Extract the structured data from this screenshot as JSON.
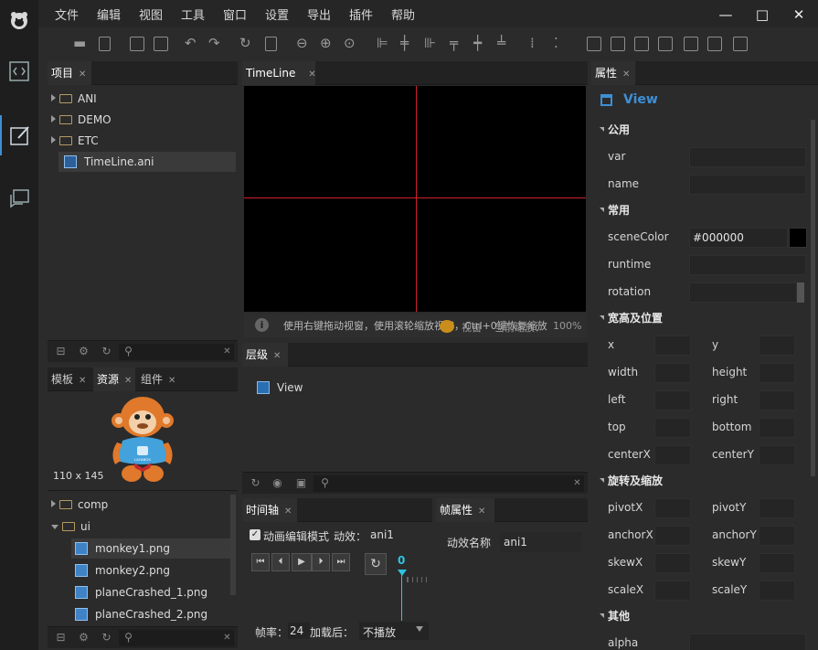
{
  "menu": [
    "文件",
    "编辑",
    "视图",
    "工具",
    "窗口",
    "设置",
    "导出",
    "插件",
    "帮助"
  ],
  "window_controls": {
    "minimize": "—",
    "maximize": "□",
    "close": "✕"
  },
  "project_panel": {
    "tab": "项目",
    "tree": [
      {
        "label": "ANI",
        "type": "folder"
      },
      {
        "label": "DEMO",
        "type": "folder"
      },
      {
        "label": "ETC",
        "type": "folder"
      },
      {
        "label": "TimeLine.ani",
        "type": "file"
      }
    ]
  },
  "resource_panel": {
    "tabs": [
      "模板",
      "资源",
      "组件"
    ],
    "preview_size": "110 x 145",
    "mascot_text": "LAYABOX",
    "tree": [
      {
        "label": "comp",
        "type": "folder"
      },
      {
        "label": "ui",
        "type": "folder-open"
      },
      {
        "label": "monkey1.png",
        "type": "image"
      },
      {
        "label": "monkey2.png",
        "type": "image"
      },
      {
        "label": "planeCrashed_1.png",
        "type": "image"
      },
      {
        "label": "planeCrashed_2.png",
        "type": "image"
      }
    ]
  },
  "timeline_panel": {
    "tab": "TimeLine",
    "status_hint": "使用右键拖动视窗，使用滚轮缩放视窗，Ctrl+0键恢复缩放",
    "view_label": "视窗",
    "current_scale": "当前缩放：",
    "zoom": "100%"
  },
  "layer_panel": {
    "tab": "层级",
    "items": [
      "View"
    ]
  },
  "axis_panel": {
    "tab": "时间轴",
    "edit_mode_label": "动画编辑模式",
    "effect_label": "动效：",
    "effect_value": "ani1",
    "frame_number": "0",
    "fps_label": "帧率：",
    "fps_value": "24",
    "after_load_label": "加载后：",
    "after_load_value": "不播放"
  },
  "frame_props_panel": {
    "tab": "帧属性",
    "name_label": "动效名称",
    "name_value": "ani1"
  },
  "props_panel": {
    "tab": "属性",
    "title": "View",
    "sections": {
      "common": "公用",
      "usual": "常用",
      "size": "宽高及位置",
      "rotate": "旋转及缩放",
      "other": "其他"
    },
    "fields": {
      "var": "var",
      "name": "name",
      "sceneColor": "sceneColor",
      "sceneColor_value": "#000000",
      "runtime": "runtime",
      "rotation": "rotation",
      "x": "x",
      "y": "y",
      "width": "width",
      "height": "height",
      "left": "left",
      "right": "right",
      "top": "top",
      "bottom": "bottom",
      "centerX": "centerX",
      "centerY": "centerY",
      "pivotX": "pivotX",
      "pivotY": "pivotY",
      "anchorX": "anchorX",
      "anchorY": "anchorY",
      "skewX": "skewX",
      "skewY": "skewY",
      "scaleX": "scaleX",
      "scaleY": "scaleY",
      "alpha": "alpha"
    }
  },
  "colors": {
    "accent": "#3d8fd6",
    "crosshair": "#d0212b",
    "canvas": "#000000"
  }
}
